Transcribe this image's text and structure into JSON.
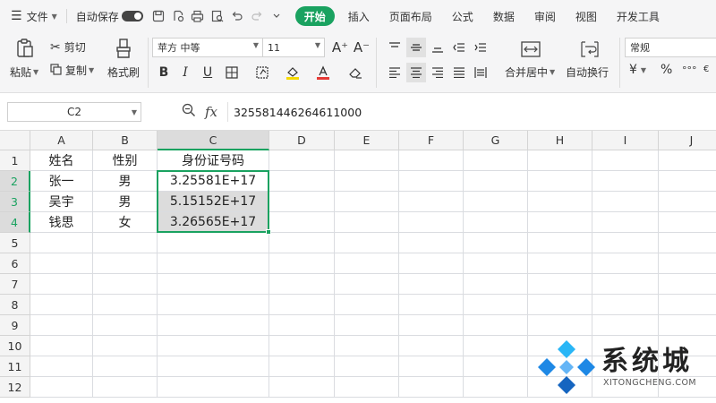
{
  "menubar": {
    "hamburger_icon": "menu-icon",
    "file_label": "文件",
    "autosave_label": "自动保存",
    "tabs": [
      "开始",
      "插入",
      "页面布局",
      "公式",
      "数据",
      "审阅",
      "视图",
      "开发工具"
    ],
    "active_tab": "开始",
    "accent": "#1aa260"
  },
  "ribbon": {
    "paste_label": "粘贴",
    "cut_label": "剪切",
    "copy_label": "复制",
    "format_painter_label": "格式刷",
    "font_name": "苹方 中等",
    "font_size": "11",
    "grow_font": "A⁺",
    "shrink_font": "A⁻",
    "bold": "B",
    "italic": "I",
    "underline": "U",
    "merge_center_label": "合并居中",
    "wrap_text_label": "自动换行",
    "number_format": "常规",
    "currency_symbol": "¥",
    "percent_symbol": "%"
  },
  "formula_bar": {
    "name_box": "C2",
    "fx_label": "fx",
    "formula_value": "325581446264611000"
  },
  "sheet": {
    "columns": [
      "A",
      "B",
      "C",
      "D",
      "E",
      "F",
      "G",
      "H",
      "I",
      "J"
    ],
    "rows": [
      "1",
      "2",
      "3",
      "4",
      "5",
      "6",
      "7",
      "8",
      "9",
      "10",
      "11",
      "12"
    ],
    "cells": {
      "A1": "姓名",
      "B1": "性别",
      "C1": "身份证号码",
      "A2": "张一",
      "B2": "男",
      "C2": "3.25581E+17",
      "A3": "吴宇",
      "B3": "男",
      "C3": "5.15152E+17",
      "A4": "钱思",
      "B4": "女",
      "C4": "3.26565E+17"
    },
    "selection_color": "#1aa260"
  },
  "watermark": {
    "title": "系统城",
    "subtitle": "XITONGCHENG.COM",
    "logo_colors": [
      "#1e88e5",
      "#29b6f6",
      "#64b5f6",
      "#1565c0"
    ]
  }
}
